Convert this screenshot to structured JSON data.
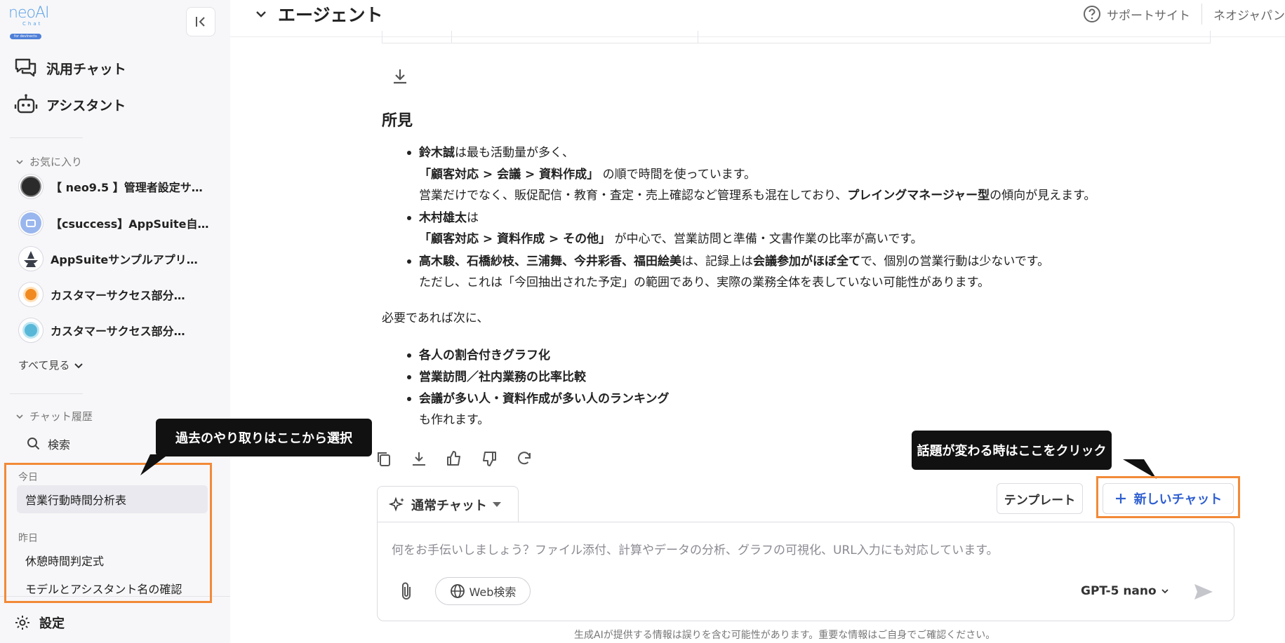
{
  "sidebar": {
    "logo": {
      "brand": "neoAI",
      "sub": "Chat",
      "pill": "for devlnects"
    },
    "nav": [
      {
        "label": "汎用チャット",
        "icon": "chat-bubbles-icon"
      },
      {
        "label": "アシスタント",
        "icon": "robot-icon"
      }
    ],
    "favorites_label": "お気に入り",
    "favorites": [
      {
        "label": "【 neo9.5 】管理者設定サ…"
      },
      {
        "label": "【csuccess】AppSuite自…"
      },
      {
        "label": "AppSuiteサンプルアプリ…"
      },
      {
        "label": "カスタマーサクセス部分…"
      },
      {
        "label": "カスタマーサクセス部分…"
      }
    ],
    "see_all": "すべて見る",
    "history_label": "チャット履歴",
    "search": "検索",
    "today_label": "今日",
    "today": [
      {
        "label": "営業行動時間分析表"
      }
    ],
    "yesterday_label": "昨日",
    "yesterday": [
      {
        "label": "休憩時間判定式"
      },
      {
        "label": "モデルとアシスタント名の確認"
      }
    ],
    "settings": "設定"
  },
  "callouts": {
    "history": "過去のやり取りはここから選択",
    "new_chat": "話題が変わる時はここをクリック"
  },
  "header": {
    "title": "エージェント",
    "support": "サポートサイト",
    "org": "ネオジャパン"
  },
  "message": {
    "heading": "所見",
    "b1_name": "鈴木誠",
    "b1_t1": "は最も活動量が多く、",
    "b1_path": "「顧客対応 > 会議 > 資料作成」",
    "b1_t2": " の順で時間を使っています。",
    "b1_t3": "営業だけでなく、販促配信・教育・査定・売上確認など管理系も混在しており、",
    "b1_bold": "プレイングマネージャー型",
    "b1_t4": "の傾向が見えます。",
    "b2_name": "木村雄太",
    "b2_t1": "は",
    "b2_path": "「顧客対応 > 資料作成 > その他」",
    "b2_t2": " が中心で、営業訪問と準備・文書作業の比率が高いです。",
    "b3_names": "高木駿、石橋紗枝、三浦舞、今井彩香、福田絵美",
    "b3_t1": "は、記録上は",
    "b3_bold": "会議参加がほぼ全て",
    "b3_t2": "で、個別の営業行動は少ないです。",
    "b3_t3": "ただし、これは「今回抽出された予定」の範囲であり、実際の業務全体を表していない可能性があります。",
    "next_intro": "必要であれば次に、",
    "next_items": [
      "各人の割合付きグラフ化",
      "営業訪問／社内業務の比率比較",
      "会議が多い人・資料作成が多い人のランキング"
    ],
    "next_outro": "も作れます。"
  },
  "composer": {
    "mode": "通常チャット",
    "template": "テンプレート",
    "new_chat": "新しいチャット",
    "placeholder": "何をお手伝いしましょう？ファイル添付、計算やデータの分析、グラフの可視化、URL入力にも対応しています。",
    "web_search": "Web検索",
    "model": "GPT-5 nano",
    "disclaimer": "生成AIが提供する情報は誤りを含む可能性があります。重要な情報はご自身でご確認ください。"
  },
  "colors": {
    "accent_orange": "#f28a38",
    "link_blue": "#2f5fd0",
    "callout_bg": "#111111"
  }
}
